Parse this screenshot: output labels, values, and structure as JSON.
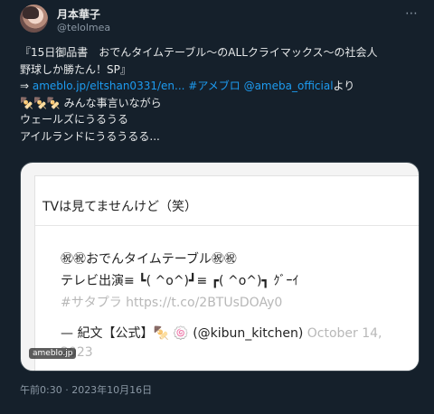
{
  "user": {
    "display_name": "月本華子",
    "handle": "@telolmea"
  },
  "more_glyph": "⋯",
  "tweet": {
    "line1": "『15日御品書　おでんタイムテーブル〜のALLクライマックス〜の社会人",
    "line2": "野球しか勝たん！SP』",
    "line3_prefix": "⇒ ",
    "link": "ameblo.jp/eltshan0331/en...",
    "hashtag": "#アメブロ",
    "mention": "@ameba_official",
    "line3_suffix": "より",
    "line4": "🍢🍢🍢 みんな事言いながら",
    "line5": "ウェールズにうるうる",
    "line6": "アイルランドにうるうるる..."
  },
  "card": {
    "lead": "TVは見てませんけど（笑）",
    "line1": "㊗㊗おでんタイムテーブル㊗㊗",
    "line2": "テレビ出演≡ ┗( ^o^)┛≡ ┏( ^o^)┓ ｸﾞｰｲ",
    "line3": "#サタプラ https://t.co/2BTUsDOAy0",
    "line4a": "— 紀文【公式】🍢 🍥 (@kibun_kitchen)",
    "line4b": "October 14,",
    "line5": "2023",
    "badge": "ameblo.jp"
  },
  "timestamp": "午前0:30 · 2023年10月16日",
  "colors": {
    "background": "#15202b",
    "text": "#e7e9ea",
    "secondary": "#8b98a5",
    "link": "#1d9bf0"
  }
}
